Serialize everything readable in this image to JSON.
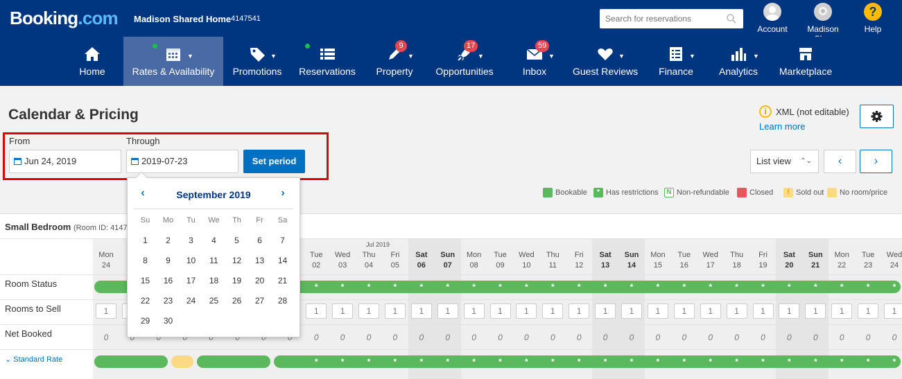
{
  "topbar": {
    "logo_main": "Booking",
    "logo_dot": ".com",
    "property_name": "Madison Shared Home",
    "property_id": "4147541",
    "search_placeholder": "Search for reservations",
    "account_label": "Account",
    "profile_label": "Madison Sh...",
    "help_label": "Help",
    "help_glyph": "?"
  },
  "nav": [
    {
      "label": "Home",
      "icon": "home-icon",
      "badge": ""
    },
    {
      "label": "Rates & Availability",
      "icon": "calendar-icon",
      "badge": ""
    },
    {
      "label": "Promotions",
      "icon": "tag-icon",
      "badge": ""
    },
    {
      "label": "Reservations",
      "icon": "list-icon",
      "badge": ""
    },
    {
      "label": "Property",
      "icon": "pencil-icon",
      "badge": "9"
    },
    {
      "label": "Opportunities",
      "icon": "rocket-icon",
      "badge": "17"
    },
    {
      "label": "Inbox",
      "icon": "envelope-icon",
      "badge": "59"
    },
    {
      "label": "Guest Reviews",
      "icon": "heart-icon",
      "badge": ""
    },
    {
      "label": "Finance",
      "icon": "invoice-icon",
      "badge": ""
    },
    {
      "label": "Analytics",
      "icon": "bar-chart-icon",
      "badge": ""
    },
    {
      "label": "Marketplace",
      "icon": "store-icon",
      "badge": ""
    }
  ],
  "page": {
    "title": "Calendar & Pricing",
    "xml_notice": "XML (not editable)",
    "learn_more": "Learn more",
    "xml_icon_glyph": "i"
  },
  "period": {
    "from_label": "From",
    "from_value": "Jun 24, 2019",
    "through_label": "Through",
    "through_value": "2019-07-23",
    "set_button": "Set period"
  },
  "view": {
    "select_value": "List view",
    "prev_glyph": "‹",
    "next_glyph": "›"
  },
  "legend": [
    {
      "label": "Bookable",
      "color": "#5cb85c",
      "glyph": ""
    },
    {
      "label": "Has restrictions",
      "color": "#5cb85c",
      "glyph": "*"
    },
    {
      "label": "Non-refundable",
      "color": "#ffffff",
      "glyph": "N"
    },
    {
      "label": "Closed",
      "color": "#e4575c",
      "glyph": ""
    },
    {
      "label": "Sold out",
      "color": "#fcd985",
      "glyph": "!"
    },
    {
      "label": "No room/price",
      "color": "#fcd985",
      "glyph": ""
    }
  ],
  "calendar": {
    "room_name": "Small Bedroom",
    "room_id_text": "(Room ID: 414754",
    "month_tag": "Jul 2019",
    "rows": [
      "Room Status",
      "Rooms to Sell",
      "Net Booked"
    ],
    "rate_label": "Standard Rate",
    "days": [
      {
        "dow": "Mon",
        "date": "24",
        "weekend": false
      },
      {
        "dow": "Tu",
        "date": "25",
        "weekend": false
      },
      {
        "dow": "",
        "date": "",
        "weekend": false
      },
      {
        "dow": "",
        "date": "",
        "weekend": false
      },
      {
        "dow": "",
        "date": "",
        "weekend": false
      },
      {
        "dow": "",
        "date": "",
        "weekend": false
      },
      {
        "dow": "",
        "date": "",
        "weekend": false
      },
      {
        "dow": "",
        "date": "",
        "weekend": false
      },
      {
        "dow": "Tue",
        "date": "02",
        "weekend": false
      },
      {
        "dow": "Wed",
        "date": "03",
        "weekend": false
      },
      {
        "dow": "Thu",
        "date": "04",
        "weekend": false
      },
      {
        "dow": "Fri",
        "date": "05",
        "weekend": false
      },
      {
        "dow": "Sat",
        "date": "06",
        "weekend": true
      },
      {
        "dow": "Sun",
        "date": "07",
        "weekend": true
      },
      {
        "dow": "Mon",
        "date": "08",
        "weekend": false
      },
      {
        "dow": "Tue",
        "date": "09",
        "weekend": false
      },
      {
        "dow": "Wed",
        "date": "10",
        "weekend": false
      },
      {
        "dow": "Thu",
        "date": "11",
        "weekend": false
      },
      {
        "dow": "Fri",
        "date": "12",
        "weekend": false
      },
      {
        "dow": "Sat",
        "date": "13",
        "weekend": true
      },
      {
        "dow": "Sun",
        "date": "14",
        "weekend": true
      },
      {
        "dow": "Mon",
        "date": "15",
        "weekend": false
      },
      {
        "dow": "Tue",
        "date": "16",
        "weekend": false
      },
      {
        "dow": "Wed",
        "date": "17",
        "weekend": false
      },
      {
        "dow": "Thu",
        "date": "18",
        "weekend": false
      },
      {
        "dow": "Fri",
        "date": "19",
        "weekend": false
      },
      {
        "dow": "Sat",
        "date": "20",
        "weekend": true
      },
      {
        "dow": "Sun",
        "date": "21",
        "weekend": true
      },
      {
        "dow": "Mon",
        "date": "22",
        "weekend": false
      },
      {
        "dow": "Tue",
        "date": "23",
        "weekend": false
      },
      {
        "dow": "Wed",
        "date": "24",
        "weekend": false
      }
    ],
    "rooms_to_sell": "1",
    "net_booked": "0",
    "star": "*"
  },
  "datepicker": {
    "title": "September 2019",
    "weekdays": [
      "Su",
      "Mo",
      "Tu",
      "We",
      "Th",
      "Fr",
      "Sa"
    ],
    "first_weekday_index": 0,
    "days_in_month": 30,
    "prev_glyph": "‹",
    "next_glyph": "›"
  }
}
